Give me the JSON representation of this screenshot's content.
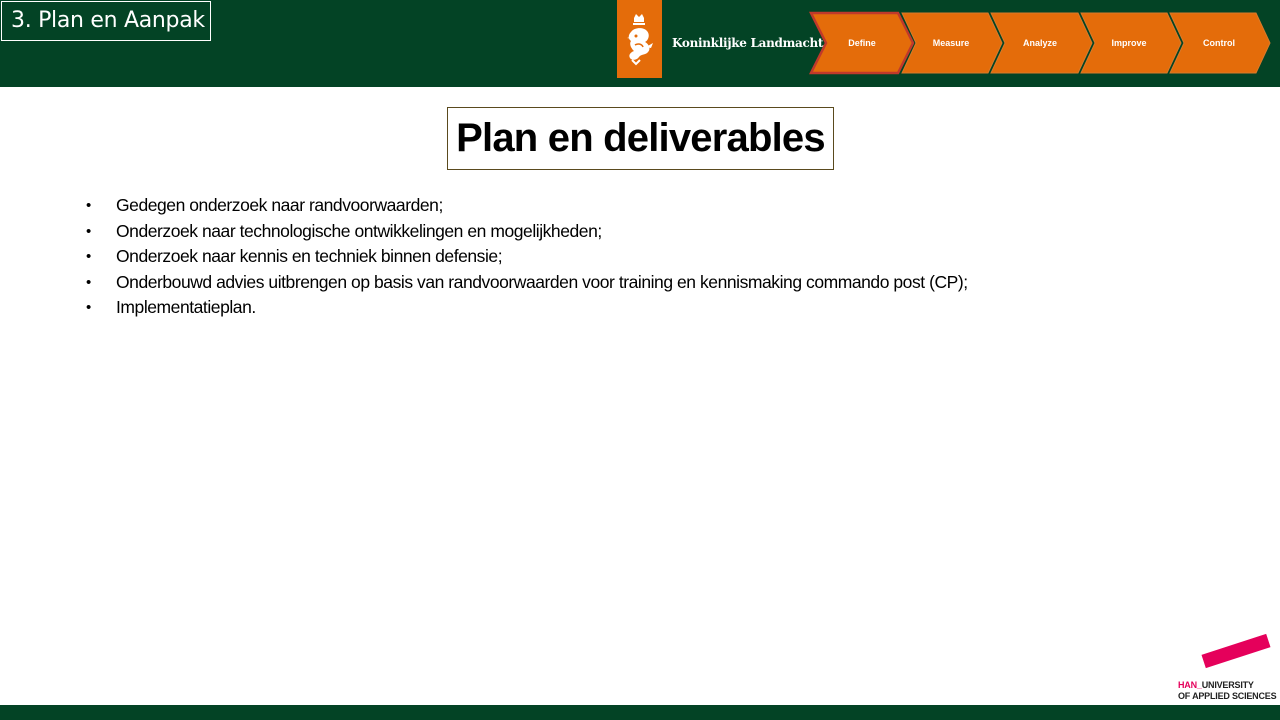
{
  "header": {
    "section_title": "3. Plan en Aanpak",
    "org_name": "Koninklijke Landmacht",
    "logo_icon": "royal-lion-crest-icon",
    "dmaic_steps": [
      {
        "label": "Define",
        "active": true
      },
      {
        "label": "Measure",
        "active": false
      },
      {
        "label": "Analyze",
        "active": false
      },
      {
        "label": "Improve",
        "active": false
      },
      {
        "label": "Control",
        "active": false
      }
    ],
    "colors": {
      "bar": "#034325",
      "chevron": "#e46c0a",
      "chevron_active_border": "#c0392b"
    }
  },
  "main": {
    "title": "Plan en deliverables",
    "bullets": [
      "Gedegen onderzoek naar randvoorwaarden;",
      "Onderzoek naar technologische ontwikkelingen en mogelijkheden;",
      "Onderzoek naar kennis en techniek binnen defensie;",
      "Onderbouwd advies uitbrengen op basis van randvoorwaarden voor training en kennismaking commando post (CP);",
      "Implementatieplan."
    ],
    "bullet_glyph": "•"
  },
  "footer": {
    "han_logo": {
      "prefix": "HAN_",
      "line1": "UNIVERSITY",
      "line2": "OF APPLIED SCIENCES",
      "accent": "#e5005b"
    }
  }
}
